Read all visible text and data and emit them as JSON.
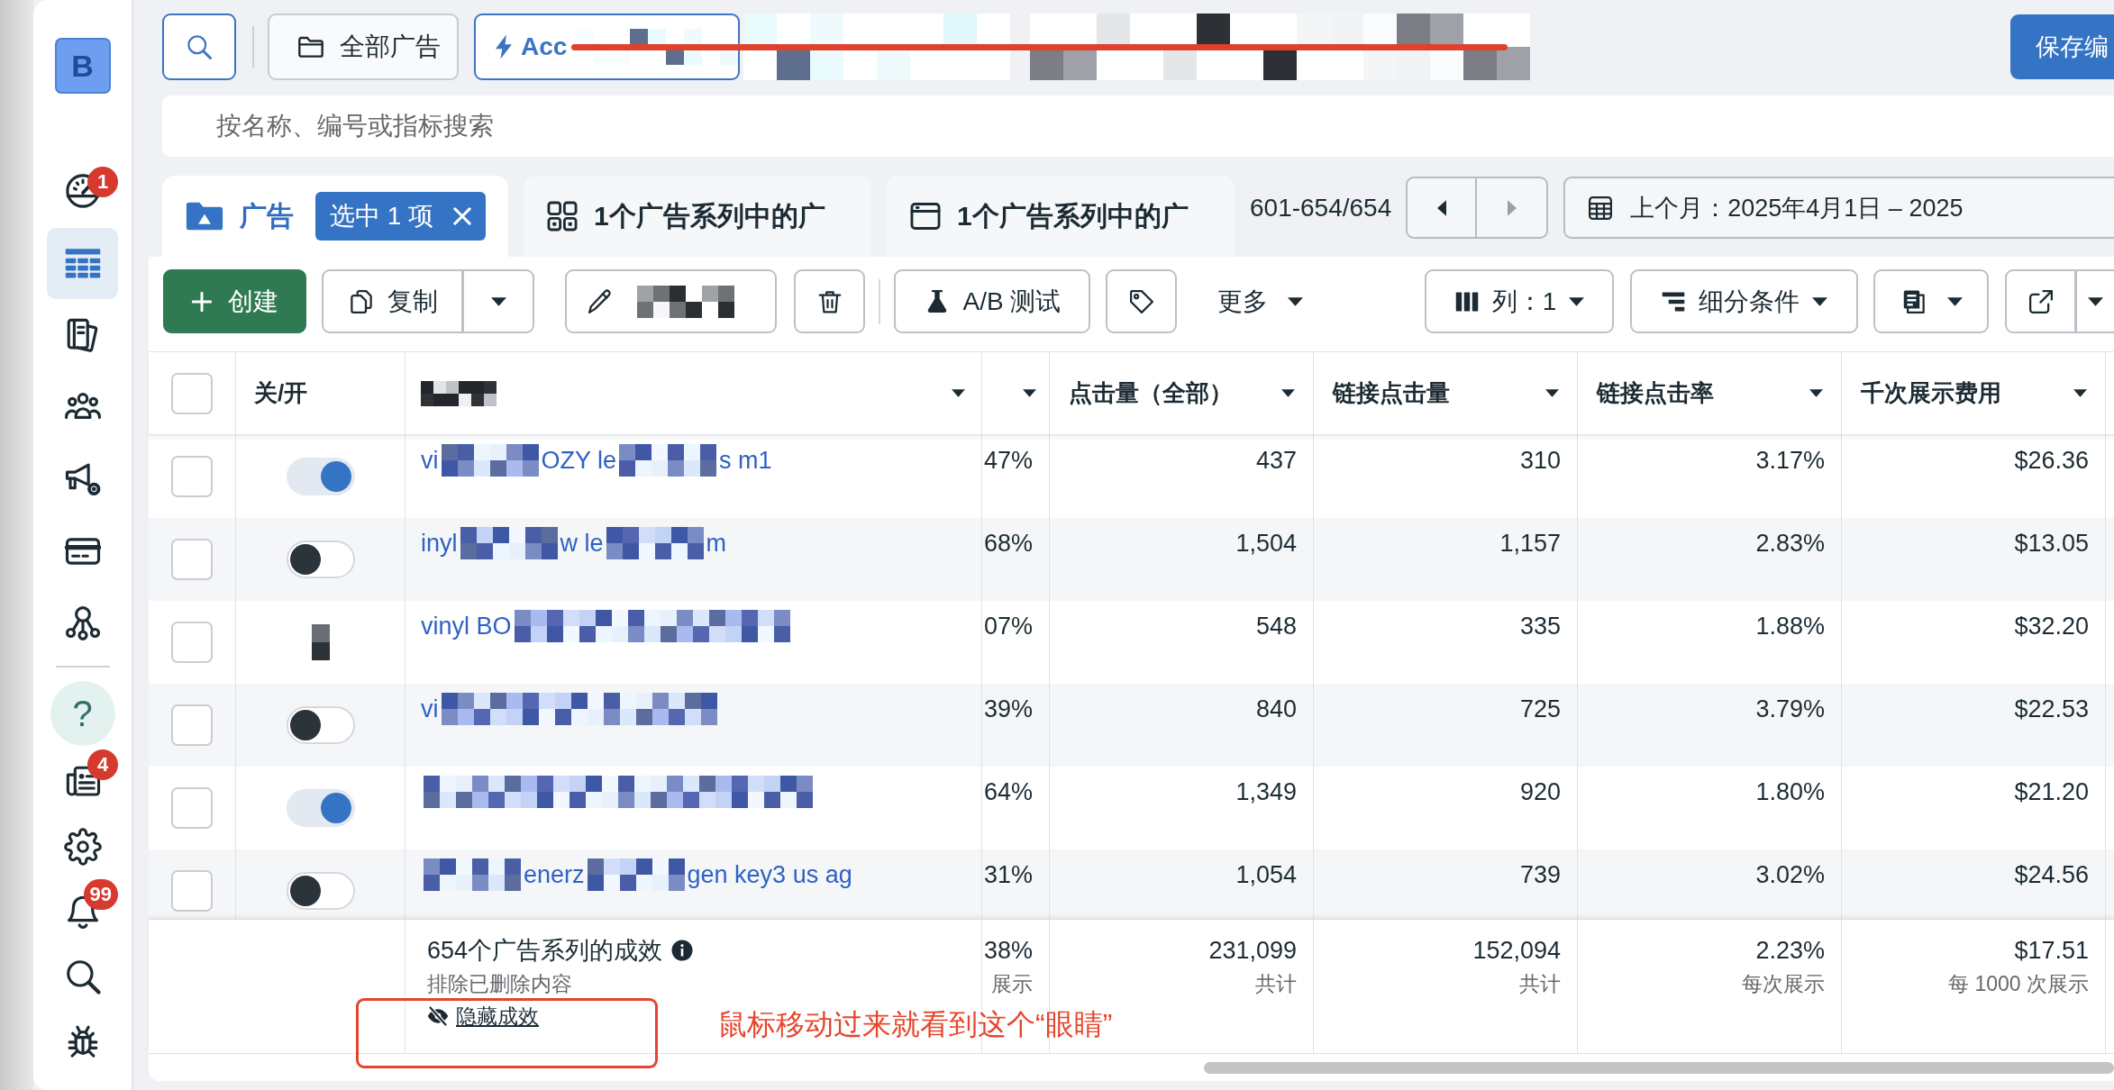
{
  "sidebar": {
    "logo": "B",
    "items": [
      {
        "kind": "gauge",
        "badge": "1",
        "selected": false
      },
      {
        "kind": "table",
        "selected": true
      },
      {
        "kind": "documents",
        "selected": false
      },
      {
        "kind": "people",
        "selected": false
      },
      {
        "kind": "megaphone",
        "selected": false
      },
      {
        "kind": "card",
        "selected": false
      },
      {
        "kind": "hierarchy",
        "selected": false
      }
    ],
    "bottom_items": [
      {
        "kind": "help",
        "label": "?",
        "selected": false
      },
      {
        "kind": "news",
        "badge": "4",
        "selected": false
      },
      {
        "kind": "gear",
        "selected": false
      },
      {
        "kind": "bell",
        "badge": "99",
        "selected": false
      },
      {
        "kind": "search",
        "selected": false
      },
      {
        "kind": "bug",
        "selected": false
      }
    ]
  },
  "top_bar": {
    "scope_button": {
      "label": "全部广告"
    },
    "account_button": {
      "label": "Acc",
      "redacted": true
    },
    "hidden_buttons": [
      {
        "redacted": true
      },
      {
        "redacted": true
      }
    ],
    "save_button": {
      "label": "保存编"
    }
  },
  "search": {
    "placeholder": "按名称、编号或指标搜索"
  },
  "tabs": [
    {
      "kind": "folder",
      "label": "广告",
      "selected": true,
      "chip": "选中 1 项"
    },
    {
      "kind": "grid",
      "label": "1个广告系列中的广",
      "selected": false
    },
    {
      "kind": "window",
      "label": "1个广告系列中的广",
      "selected": false
    }
  ],
  "pagination": {
    "range": "601-654/654",
    "prev": {
      "disabled": false
    },
    "next": {
      "disabled": true
    }
  },
  "date_range": {
    "label": "上个月：2025年4月1日 – 2025"
  },
  "toolbar": {
    "left": [
      {
        "kind": "create",
        "label": "创建"
      },
      {
        "kind": "copy",
        "label": "复制"
      },
      {
        "kind": "edit",
        "redacted": true
      },
      {
        "kind": "delete"
      },
      {
        "kind": "ab-test",
        "label": "A/B 测试"
      },
      {
        "kind": "tag"
      },
      {
        "kind": "more",
        "label": "更多"
      }
    ],
    "right": [
      {
        "kind": "columns",
        "label": "列：1"
      },
      {
        "kind": "breakdown",
        "label": "细分条件"
      },
      {
        "kind": "report"
      },
      {
        "kind": "export"
      }
    ]
  },
  "table": {
    "columns": [
      {
        "kind": "select",
        "checked": false
      },
      {
        "kind": "label",
        "label": "关/开"
      },
      {
        "kind": "redacted"
      },
      {
        "kind": "caret"
      },
      {
        "kind": "metric",
        "label": "点击量（全部）"
      },
      {
        "kind": "metric",
        "label": "链接点击量"
      },
      {
        "kind": "metric",
        "label": "链接点击率"
      },
      {
        "kind": "metric",
        "label": "千次展示费用"
      }
    ],
    "rows": [
      {
        "selected": false,
        "toggle": {
          "on": true
        },
        "name": [
          {
            "kind": "text",
            "text": "vi"
          },
          {
            "kind": "redacted"
          },
          {
            "kind": "text",
            "text": "OZY le"
          },
          {
            "kind": "redacted"
          },
          {
            "kind": "text",
            "text": "s m1"
          }
        ],
        "cells": [
          "47%",
          "437",
          "310",
          "3.17%",
          "$26.36"
        ]
      },
      {
        "selected": false,
        "toggle": {
          "on": false
        },
        "name": [
          {
            "kind": "text",
            "text": "inyl"
          },
          {
            "kind": "redacted"
          },
          {
            "kind": "text",
            "text": "w le"
          },
          {
            "kind": "redacted"
          },
          {
            "kind": "text",
            "text": "m"
          }
        ],
        "cells": [
          "68%",
          "1,504",
          "1,157",
          "2.83%",
          "$13.05"
        ]
      },
      {
        "selected": false,
        "toggle": {
          "redacted": true
        },
        "name": [
          {
            "kind": "text",
            "text": "vinyl BO"
          },
          {
            "kind": "redacted"
          }
        ],
        "cells": [
          "07%",
          "548",
          "335",
          "1.88%",
          "$32.20"
        ]
      },
      {
        "selected": false,
        "toggle": {
          "on": false
        },
        "name": [
          {
            "kind": "text",
            "text": "vi"
          },
          {
            "kind": "redacted"
          }
        ],
        "cells": [
          "39%",
          "840",
          "725",
          "3.79%",
          "$22.53"
        ]
      },
      {
        "selected": false,
        "toggle": {
          "on": true
        },
        "name": [
          {
            "kind": "redacted"
          }
        ],
        "cells": [
          "64%",
          "1,349",
          "920",
          "1.80%",
          "$21.20"
        ]
      },
      {
        "selected": false,
        "toggle": {
          "on": false
        },
        "name": [
          {
            "kind": "redacted"
          },
          {
            "kind": "text",
            "text": "enerz"
          },
          {
            "kind": "redacted"
          },
          {
            "kind": "text",
            "text": "gen key3 us ag"
          }
        ],
        "cells": [
          "31%",
          "1,054",
          "739",
          "3.02%",
          "$24.56"
        ]
      }
    ],
    "summary": {
      "title": "654个广告系列的成效",
      "note": "排除已删除内容",
      "hide_link": "隐藏成效",
      "cells": [
        {
          "value": "38%",
          "caption": "展示"
        },
        {
          "value": "231,099",
          "caption": "共计"
        },
        {
          "value": "152,094",
          "caption": "共计"
        },
        {
          "value": "2.23%",
          "caption": "每次展示"
        },
        {
          "value": "$17.51",
          "caption": "每 1000 次展示"
        }
      ]
    }
  },
  "annotations": [
    {
      "kind": "strike-line"
    },
    {
      "kind": "highlight-box"
    },
    {
      "kind": "note",
      "text": "鼠标移动过来就看到这个“眼睛”"
    }
  ]
}
